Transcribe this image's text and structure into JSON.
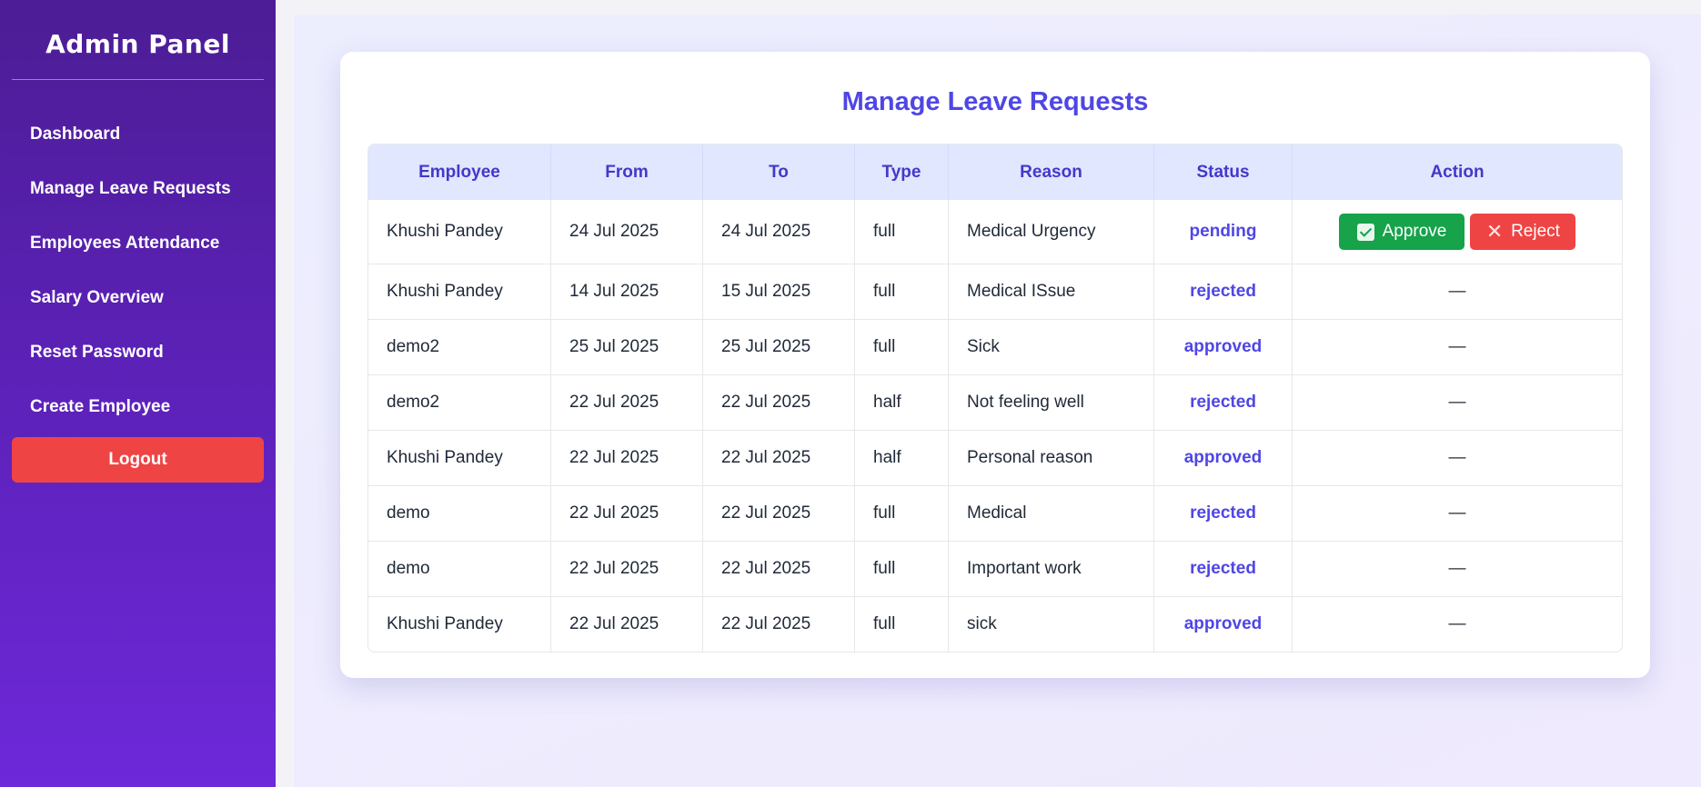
{
  "sidebar": {
    "brand": "Admin Panel",
    "items": [
      {
        "label": "Dashboard"
      },
      {
        "label": "Manage Leave Requests"
      },
      {
        "label": "Employees Attendance"
      },
      {
        "label": "Salary Overview"
      },
      {
        "label": "Reset Password"
      },
      {
        "label": "Create Employee"
      }
    ],
    "logout_label": "Logout"
  },
  "main": {
    "title": "Manage Leave Requests",
    "columns": [
      "Employee",
      "From",
      "To",
      "Type",
      "Reason",
      "Status",
      "Action"
    ],
    "rows": [
      {
        "employee": "Khushi Pandey",
        "from": "24 Jul 2025",
        "to": "24 Jul 2025",
        "type": "full",
        "reason": "Medical Urgency",
        "status": "pending",
        "action": null
      },
      {
        "employee": "Khushi Pandey",
        "from": "14 Jul 2025",
        "to": "15 Jul 2025",
        "type": "full",
        "reason": "Medical ISsue",
        "status": "rejected",
        "action": "—"
      },
      {
        "employee": "demo2",
        "from": "25 Jul 2025",
        "to": "25 Jul 2025",
        "type": "full",
        "reason": "Sick",
        "status": "approved",
        "action": "—"
      },
      {
        "employee": "demo2",
        "from": "22 Jul 2025",
        "to": "22 Jul 2025",
        "type": "half",
        "reason": "Not feeling well",
        "status": "rejected",
        "action": "—"
      },
      {
        "employee": "Khushi Pandey",
        "from": "22 Jul 2025",
        "to": "22 Jul 2025",
        "type": "half",
        "reason": "Personal reason",
        "status": "approved",
        "action": "—"
      },
      {
        "employee": "demo",
        "from": "22 Jul 2025",
        "to": "22 Jul 2025",
        "type": "full",
        "reason": "Medical",
        "status": "rejected",
        "action": "—"
      },
      {
        "employee": "demo",
        "from": "22 Jul 2025",
        "to": "22 Jul 2025",
        "type": "full",
        "reason": "Important work",
        "status": "rejected",
        "action": "—"
      },
      {
        "employee": "Khushi Pandey",
        "from": "22 Jul 2025",
        "to": "22 Jul 2025",
        "type": "full",
        "reason": "sick",
        "status": "approved",
        "action": "—"
      }
    ],
    "approve_label": "Approve",
    "reject_label": "Reject",
    "approve_icon": "check-square-icon",
    "reject_icon": "x-icon"
  },
  "colors": {
    "sidebar_top": "#4c1d95",
    "sidebar_bottom": "#6d28d9",
    "accent": "#4f46e5",
    "approve": "#16a34a",
    "reject": "#ef4444",
    "header_bg": "#e0e7ff"
  }
}
